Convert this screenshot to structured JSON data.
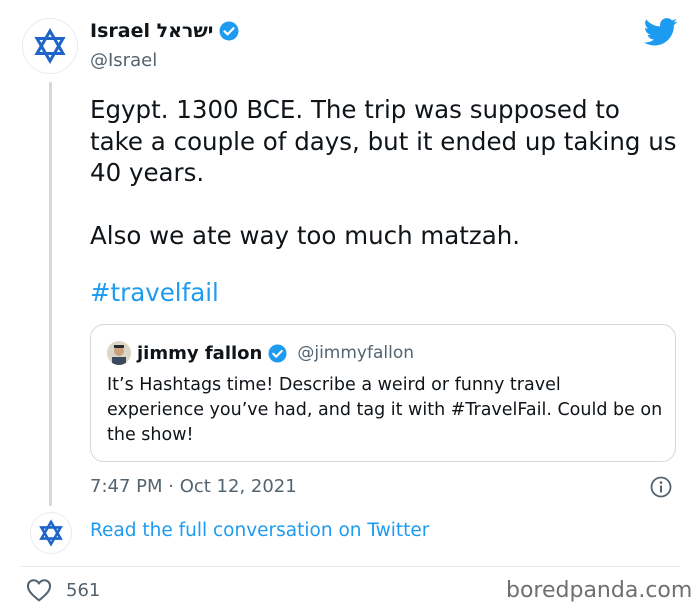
{
  "author": {
    "name": "Israel ישראל",
    "handle": "@Israel",
    "verified_icon": "verified-badge-icon"
  },
  "tweet": {
    "line1": "Egypt. 1300 BCE. The trip was supposed to take a couple of days, but it ended up taking us 40 years.",
    "line2": "Also we ate way too much matzah.",
    "hashtag": "#travelfail"
  },
  "quoted_tweet": {
    "name": "jimmy fallon",
    "handle": "@jimmyfallon",
    "text": "It’s Hashtags time! Describe a weird or funny travel experience you’ve had, and tag it with #TravelFail. Could be on the show!"
  },
  "meta": {
    "timestamp": "7:47 PM · Oct 12, 2021"
  },
  "conversation_link": "Read the full conversation on Twitter",
  "likes": {
    "count": "561"
  },
  "watermark": "boredpanda.com",
  "colors": {
    "brand_blue": "#1d9bf0",
    "israel_blue": "#1f64c8",
    "secondary_text": "#536471"
  }
}
